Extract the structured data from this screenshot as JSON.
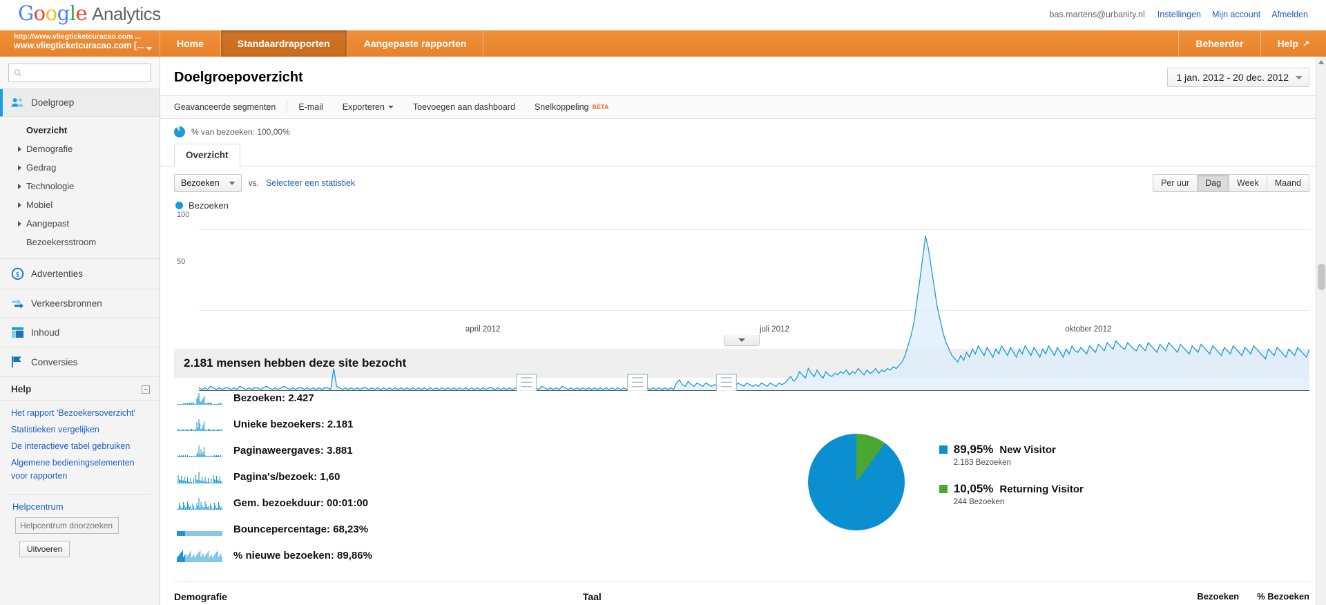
{
  "header": {
    "logo_google": "Google",
    "logo_product": "Analytics",
    "email": "bas.martens@urbanity.nl",
    "links": [
      "Instellingen",
      "Mijn account",
      "Afmelden"
    ]
  },
  "nav": {
    "profile_url": "http://www.vliegticketcuracao.com ...",
    "profile_name": "www.vliegticketcuracao.com [...",
    "tabs": [
      "Home",
      "Standaardrapporten",
      "Aangepaste rapporten"
    ],
    "active_tab": "Standaardrapporten",
    "right_items": [
      "Beheerder",
      "Help"
    ]
  },
  "sidebar": {
    "search_placeholder": "",
    "sections": [
      {
        "label": "Doelgroep",
        "icon": "audience-icon",
        "active": true
      },
      {
        "label": "Advertenties",
        "icon": "dollar-icon",
        "active": false
      },
      {
        "label": "Verkeersbronnen",
        "icon": "arrows-icon",
        "active": false
      },
      {
        "label": "Inhoud",
        "icon": "content-icon",
        "active": false
      },
      {
        "label": "Conversies",
        "icon": "flag-icon",
        "active": false
      }
    ],
    "doelgroep_subs": [
      {
        "label": "Overzicht",
        "expandable": false,
        "selected": true
      },
      {
        "label": "Demografie",
        "expandable": true,
        "selected": false
      },
      {
        "label": "Gedrag",
        "expandable": true,
        "selected": false
      },
      {
        "label": "Technologie",
        "expandable": true,
        "selected": false
      },
      {
        "label": "Mobiel",
        "expandable": true,
        "selected": false
      },
      {
        "label": "Aangepast",
        "expandable": true,
        "selected": false
      },
      {
        "label": "Bezoekersstroom",
        "expandable": false,
        "selected": false
      }
    ],
    "help_title": "Help",
    "help_links": [
      "Het rapport 'Bezoekersoverzicht'",
      "Statistieken vergelijken",
      "De interactieve tabel gebruiken",
      "Algemene bedieningselementen voor rapporten"
    ],
    "helpcentrum_label": "Helpcentrum",
    "helpcentrum_placeholder": "Helpcentrum doorzoeken",
    "helpcentrum_button": "Uitvoeren"
  },
  "page": {
    "title": "Doelgroepoverzicht",
    "date_range": "1 jan. 2012 - 20 dec. 2012",
    "toolbar": [
      "Geavanceerde segmenten",
      "E-mail",
      "Exporteren",
      "Toevoegen aan dashboard",
      "Snelkoppeling"
    ],
    "beta_badge": "BÈTA",
    "segment_text": "% van bezoeken: 100,00%",
    "tab_label": "Overzicht"
  },
  "chart_controls": {
    "metric": "Bezoeken",
    "vs_label": "vs.",
    "compare_link": "Selecteer een statistiek",
    "granularity": [
      "Per uur",
      "Dag",
      "Week",
      "Maand"
    ],
    "granularity_active": "Dag",
    "legend_label": "Bezoeken"
  },
  "summary_headline": "2.181 mensen hebben deze site bezocht",
  "stats": [
    {
      "label": "Bezoeken:",
      "value": "2.427"
    },
    {
      "label": "Unieke bezoekers:",
      "value": "2.181"
    },
    {
      "label": "Paginaweergaves:",
      "value": "3.881"
    },
    {
      "label": "Pagina's/bezoek:",
      "value": "1,60"
    },
    {
      "label": "Gem. bezoekduur:",
      "value": "00:01:00"
    },
    {
      "label": "Bouncepercentage:",
      "value": "68,23%"
    },
    {
      "label": "% nieuwe bezoeken:",
      "value": "89,86%"
    }
  ],
  "bottom": {
    "demografie_label": "Demografie",
    "taal_label": "Taal",
    "col_bezoeken": "Bezoeken",
    "col_pct_bezoeken": "% Bezoeken"
  },
  "colors": {
    "orange": "#e8822c",
    "blue": "#0c8fd0",
    "green": "#4aa832",
    "link": "#1b5fbe"
  },
  "chart_data": {
    "type": "line",
    "title": "Bezoeken",
    "xlabel": "",
    "ylabel": "Bezoeken",
    "ylim": [
      0,
      110
    ],
    "yticks": [
      50,
      100
    ],
    "grid": true,
    "legend": [
      "Bezoeken"
    ],
    "legend_position": "top-left",
    "x_tick_labels": [
      "april 2012",
      "juli 2012",
      "oktober 2012"
    ],
    "x_tick_positions_pct": [
      24.0,
      50.5,
      78.0
    ],
    "annotations_pct": [
      29.5,
      39.5,
      47.5
    ],
    "series": [
      {
        "name": "Bezoeken",
        "color": "#1a9ad6",
        "values": [
          2,
          1,
          2,
          1,
          3,
          2,
          1,
          2,
          1,
          2,
          2,
          1,
          2,
          1,
          3,
          2,
          1,
          2,
          1,
          2,
          2,
          1,
          2,
          3,
          2,
          1,
          2,
          1,
          2,
          3,
          2,
          1,
          2,
          1,
          2,
          2,
          1,
          2,
          1,
          2,
          1,
          2,
          1,
          2,
          2,
          1,
          14,
          3,
          2,
          1,
          2,
          1,
          2,
          1,
          2,
          1,
          2,
          2,
          1,
          2,
          1,
          2,
          1,
          2,
          1,
          2,
          1,
          2,
          1,
          2,
          1,
          2,
          1,
          2,
          1,
          2,
          1,
          2,
          1,
          2,
          1,
          2,
          1,
          2,
          1,
          2,
          1,
          2,
          1,
          2,
          1,
          2,
          1,
          2,
          1,
          2,
          1,
          2,
          1,
          2,
          2,
          1,
          2,
          1,
          2,
          1,
          2,
          1,
          2,
          1,
          2,
          1,
          2,
          4,
          3,
          2,
          1,
          3,
          2,
          1,
          2,
          1,
          2,
          1,
          3,
          2,
          1,
          2,
          1,
          2,
          1,
          2,
          1,
          2,
          1,
          2,
          1,
          2,
          1,
          2,
          1,
          2,
          1,
          2,
          1,
          2,
          1,
          2,
          1,
          2,
          1,
          2,
          1,
          2,
          1,
          2,
          1,
          2,
          1,
          2,
          1,
          2,
          1,
          5,
          7,
          4,
          3,
          6,
          4,
          3,
          5,
          4,
          3,
          5,
          4,
          3,
          4,
          3,
          5,
          4,
          3,
          5,
          4,
          3,
          5,
          4,
          3,
          5,
          4,
          3,
          4,
          3,
          5,
          4,
          3,
          5,
          4,
          3,
          5,
          4,
          5,
          7,
          9,
          6,
          8,
          12,
          10,
          8,
          14,
          11,
          9,
          13,
          10,
          8,
          12,
          10,
          9,
          11,
          10,
          12,
          11,
          13,
          10,
          12,
          11,
          14,
          12,
          10,
          13,
          11,
          12,
          14,
          11,
          13,
          12,
          14,
          13,
          15,
          14,
          16,
          18,
          22,
          28,
          34,
          42,
          55,
          68,
          82,
          96,
          88,
          76,
          64,
          52,
          44,
          36,
          30,
          26,
          22,
          20,
          18,
          22,
          19,
          24,
          21,
          26,
          23,
          28,
          25,
          22,
          27,
          24,
          21,
          26,
          23,
          28,
          25,
          22,
          27,
          24,
          21,
          26,
          23,
          28,
          25,
          22,
          27,
          24,
          21,
          26,
          23,
          28,
          25,
          22,
          27,
          24,
          21,
          26,
          23,
          28,
          25,
          24,
          27,
          25,
          23,
          28,
          26,
          24,
          29,
          27,
          25,
          30,
          28,
          26,
          31,
          29,
          27,
          26,
          30,
          28,
          26,
          25,
          29,
          27,
          25,
          30,
          28,
          26,
          24,
          29,
          27,
          25,
          30,
          28,
          26,
          24,
          29,
          27,
          25,
          23,
          28,
          26,
          24,
          29,
          27,
          25,
          23,
          28,
          26,
          24,
          22,
          27,
          25,
          23,
          28,
          26,
          24,
          22,
          27,
          25,
          23,
          28,
          26,
          24,
          22,
          20,
          26,
          24,
          22,
          27,
          25,
          23,
          21,
          26,
          24,
          22,
          27,
          25,
          23,
          21,
          26
        ]
      }
    ]
  }
}
